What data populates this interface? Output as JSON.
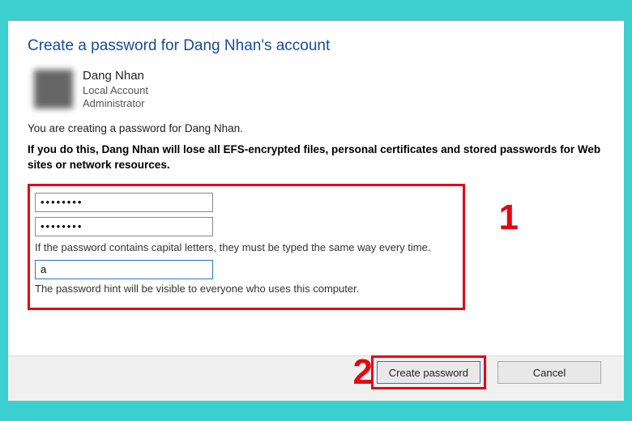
{
  "title": "Create a password for Dang Nhan's account",
  "user": {
    "name": "Dang Nhan",
    "type": "Local Account",
    "role": "Administrator"
  },
  "info": "You are creating a password for Dang Nhan.",
  "warning": "If you do this, Dang Nhan will lose all EFS-encrypted files, personal certificates and stored passwords for Web sites or network resources.",
  "form": {
    "password_value": "••••••••",
    "confirm_value": "••••••••",
    "password_note": "If the password contains capital letters, they must be typed the same way every time.",
    "hint_value": "a",
    "hint_note": "The password hint will be visible to everyone who uses this computer."
  },
  "buttons": {
    "create": "Create password",
    "cancel": "Cancel"
  },
  "annotations": {
    "step1": "1",
    "step2": "2"
  }
}
